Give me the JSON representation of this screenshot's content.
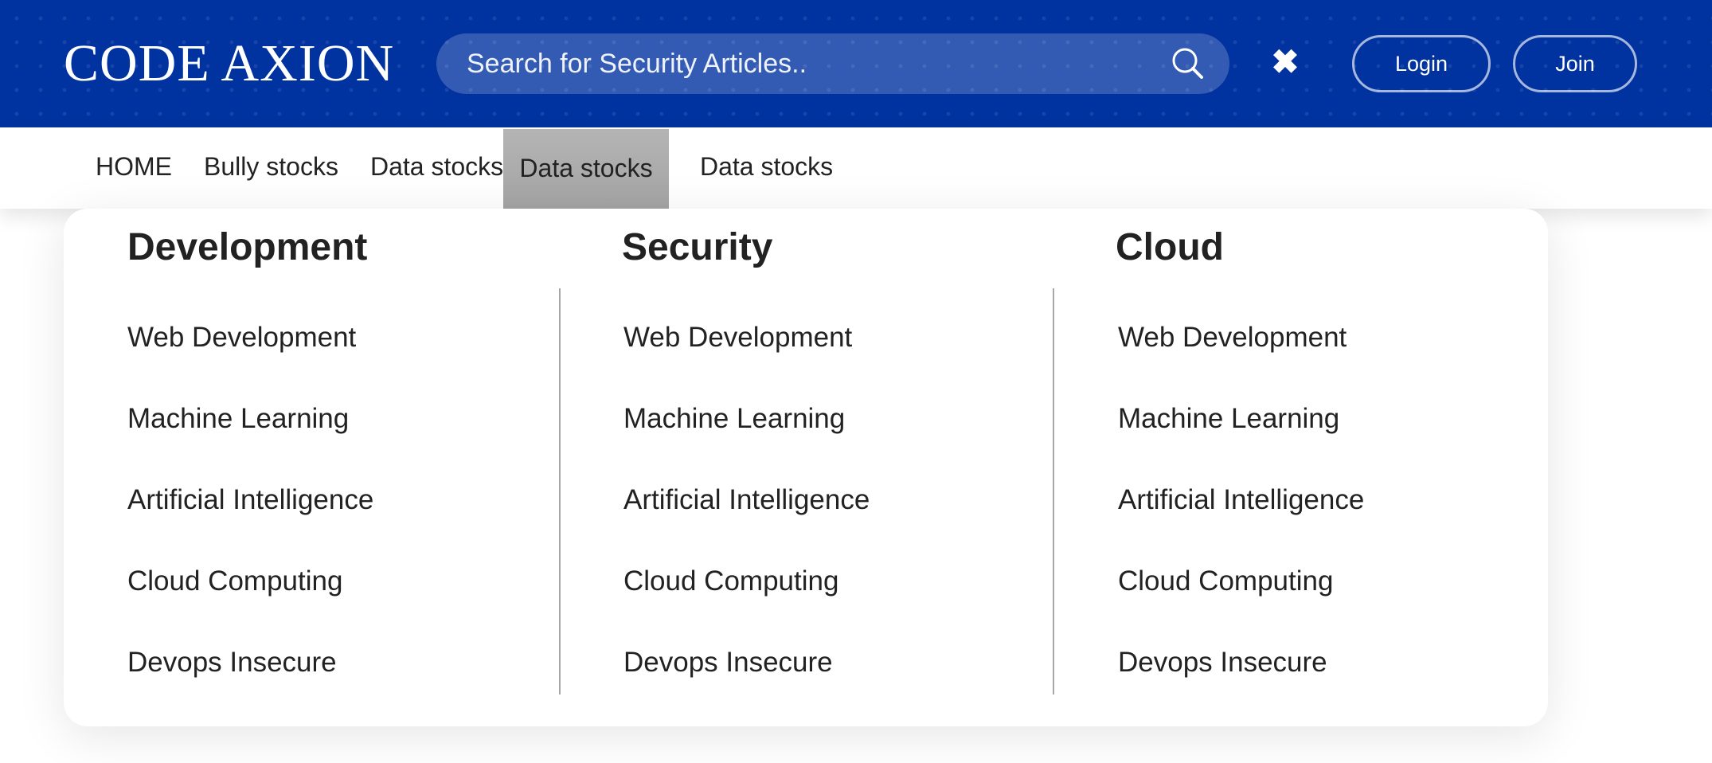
{
  "header": {
    "logo": "CODE AXION",
    "search": {
      "placeholder": "Search for Security Articles..",
      "value": ""
    },
    "close_symbol": "✖",
    "login_label": "Login",
    "join_label": "Join",
    "colors": {
      "background": "#0033a0",
      "text": "#ffffff"
    }
  },
  "nav": {
    "items": [
      {
        "label": "HOME"
      },
      {
        "label": "Bully stocks"
      },
      {
        "label": "Data stocks"
      },
      {
        "label": "Data stocks",
        "active": true
      },
      {
        "label": "Data stocks"
      }
    ],
    "active_color": "#ababab"
  },
  "dropdown": {
    "columns": [
      {
        "heading": "Development",
        "items": [
          "Web Development",
          "Machine Learning",
          "Artificial Intelligence",
          "Cloud Computing",
          "Devops Insecure"
        ]
      },
      {
        "heading": "Security",
        "items": [
          "Web Development",
          "Machine Learning",
          "Artificial Intelligence",
          "Cloud Computing",
          "Devops Insecure"
        ]
      },
      {
        "heading": "Cloud",
        "items": [
          "Web Development",
          "Machine Learning",
          "Artificial Intelligence",
          "Cloud Computing",
          "Devops Insecure"
        ]
      }
    ]
  }
}
